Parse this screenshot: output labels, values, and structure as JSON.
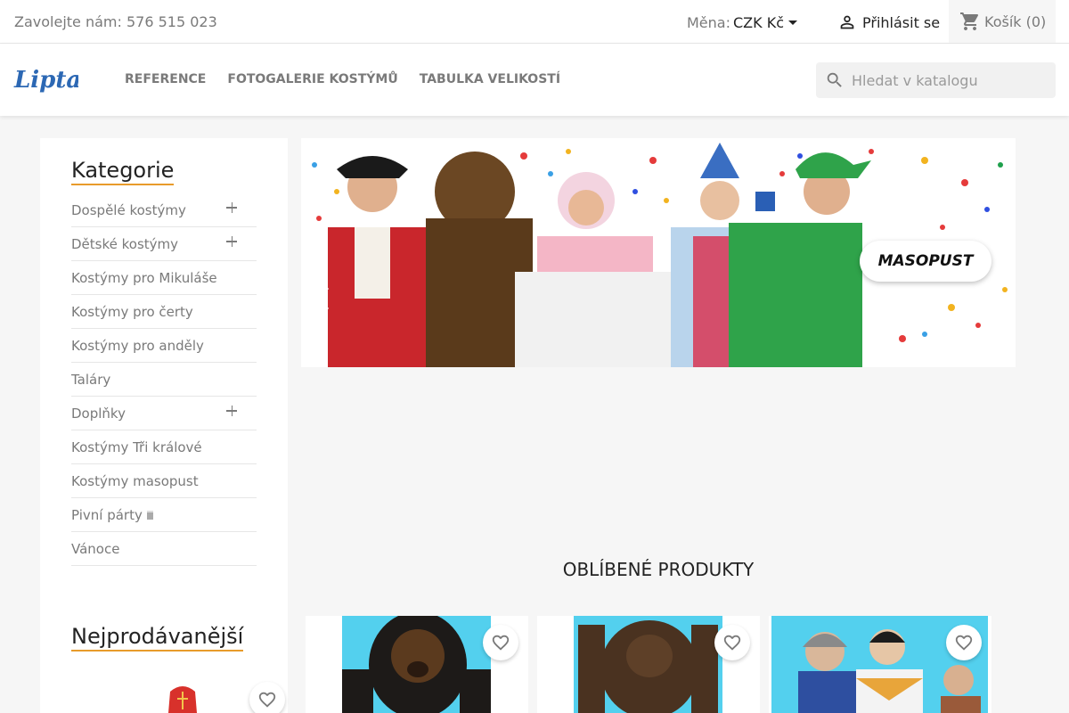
{
  "topbar": {
    "contact": "Zavolejte nám: 576 515 023",
    "currency_label": "Měna:",
    "currency_value": "CZK Kč",
    "signin_label": "Přihlásit se",
    "cart_label": "Košík",
    "cart_count": "(0)"
  },
  "header": {
    "logo_text": "Lipta",
    "nav": [
      "REFERENCE",
      "FOTOGALERIE KOSTÝMŮ",
      "TABULKA VELIKOSTÍ"
    ],
    "search_placeholder": "Hledat v katalogu"
  },
  "sidebar": {
    "title": "Kategorie",
    "items": [
      {
        "label": "Dospělé kostýmy",
        "expandable": true
      },
      {
        "label": "Dětské kostýmy",
        "expandable": true
      },
      {
        "label": "Kostýmy pro Mikuláše",
        "expandable": false
      },
      {
        "label": "Kostýmy pro čerty",
        "expandable": false
      },
      {
        "label": "Kostýmy pro anděly",
        "expandable": false
      },
      {
        "label": "Taláry",
        "expandable": false
      },
      {
        "label": "Doplňky",
        "expandable": true
      },
      {
        "label": "Kostýmy Tři králové",
        "expandable": false
      },
      {
        "label": "Kostýmy masopust",
        "expandable": false
      },
      {
        "label": "Pivní párty",
        "expandable": false
      },
      {
        "label": "Vánoce",
        "expandable": false
      }
    ],
    "bestsellers_title": "Nejprodávanější"
  },
  "banner": {
    "badge_text": "MASOPUST"
  },
  "products": {
    "title": "OBLÍBENÉ PRODUKTY"
  },
  "colors": {
    "accent": "#e89b2b",
    "product_bg": "#53d0ee",
    "logo": "#2c68b4"
  }
}
